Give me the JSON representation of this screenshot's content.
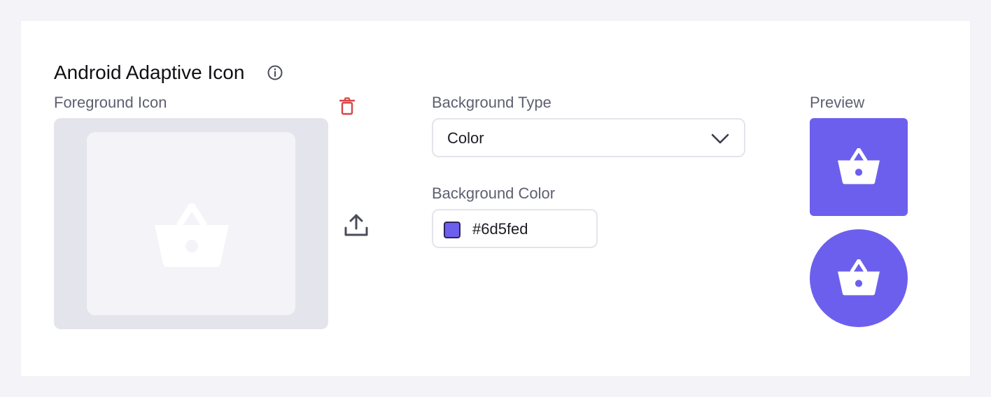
{
  "section": {
    "title": "Android Adaptive Icon",
    "info_icon": "info-circle-icon"
  },
  "foreground": {
    "label": "Foreground Icon",
    "placeholder_icon": "shopping-basket-icon",
    "delete_icon": "trash-icon",
    "upload_icon": "upload-icon"
  },
  "background_type": {
    "label": "Background Type",
    "value": "Color",
    "dropdown_icon": "chevron-down-icon"
  },
  "background_color": {
    "label": "Background Color",
    "value": "#6d5fed",
    "swatch_color": "#6d5fed"
  },
  "preview": {
    "label": "Preview",
    "icon": "shopping-basket-icon"
  },
  "colors": {
    "accent": "#6d5fed",
    "danger": "#d64545",
    "muted_text": "#5e6070",
    "placeholder_bg": "#e4e4ec",
    "placeholder_inner": "#f3f3f8"
  }
}
